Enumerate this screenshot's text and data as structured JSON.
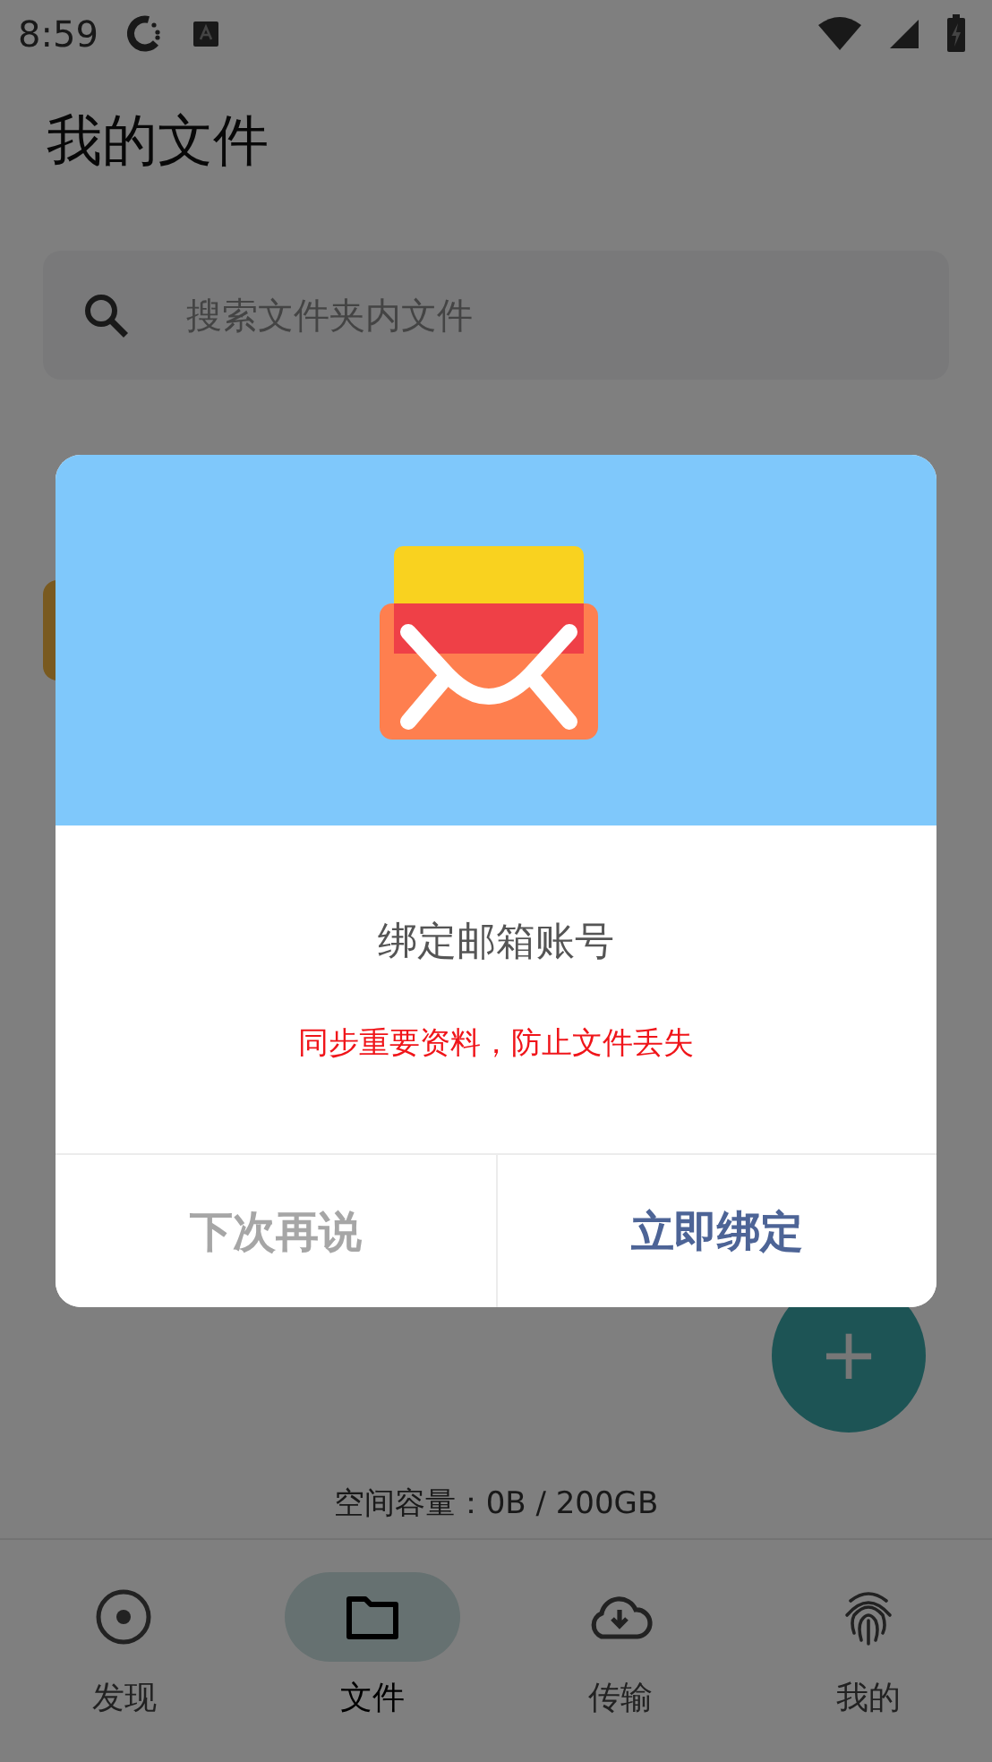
{
  "status_bar": {
    "time": "8:59"
  },
  "title": "我的文件",
  "search": {
    "placeholder": "搜索文件夹内文件"
  },
  "storage": "空间容量：0B / 200GB",
  "fab": {
    "label": "+"
  },
  "tabs": [
    {
      "label": "发现",
      "selected": false
    },
    {
      "label": "文件",
      "selected": true
    },
    {
      "label": "传输",
      "selected": false
    },
    {
      "label": "我的",
      "selected": false
    }
  ],
  "dialog": {
    "title": "绑定邮箱账号",
    "message": "同步重要资料，防止文件丢失",
    "buttons": [
      {
        "label": "下次再说",
        "kind": "secondary"
      },
      {
        "label": "立即绑定",
        "kind": "primary"
      }
    ]
  }
}
